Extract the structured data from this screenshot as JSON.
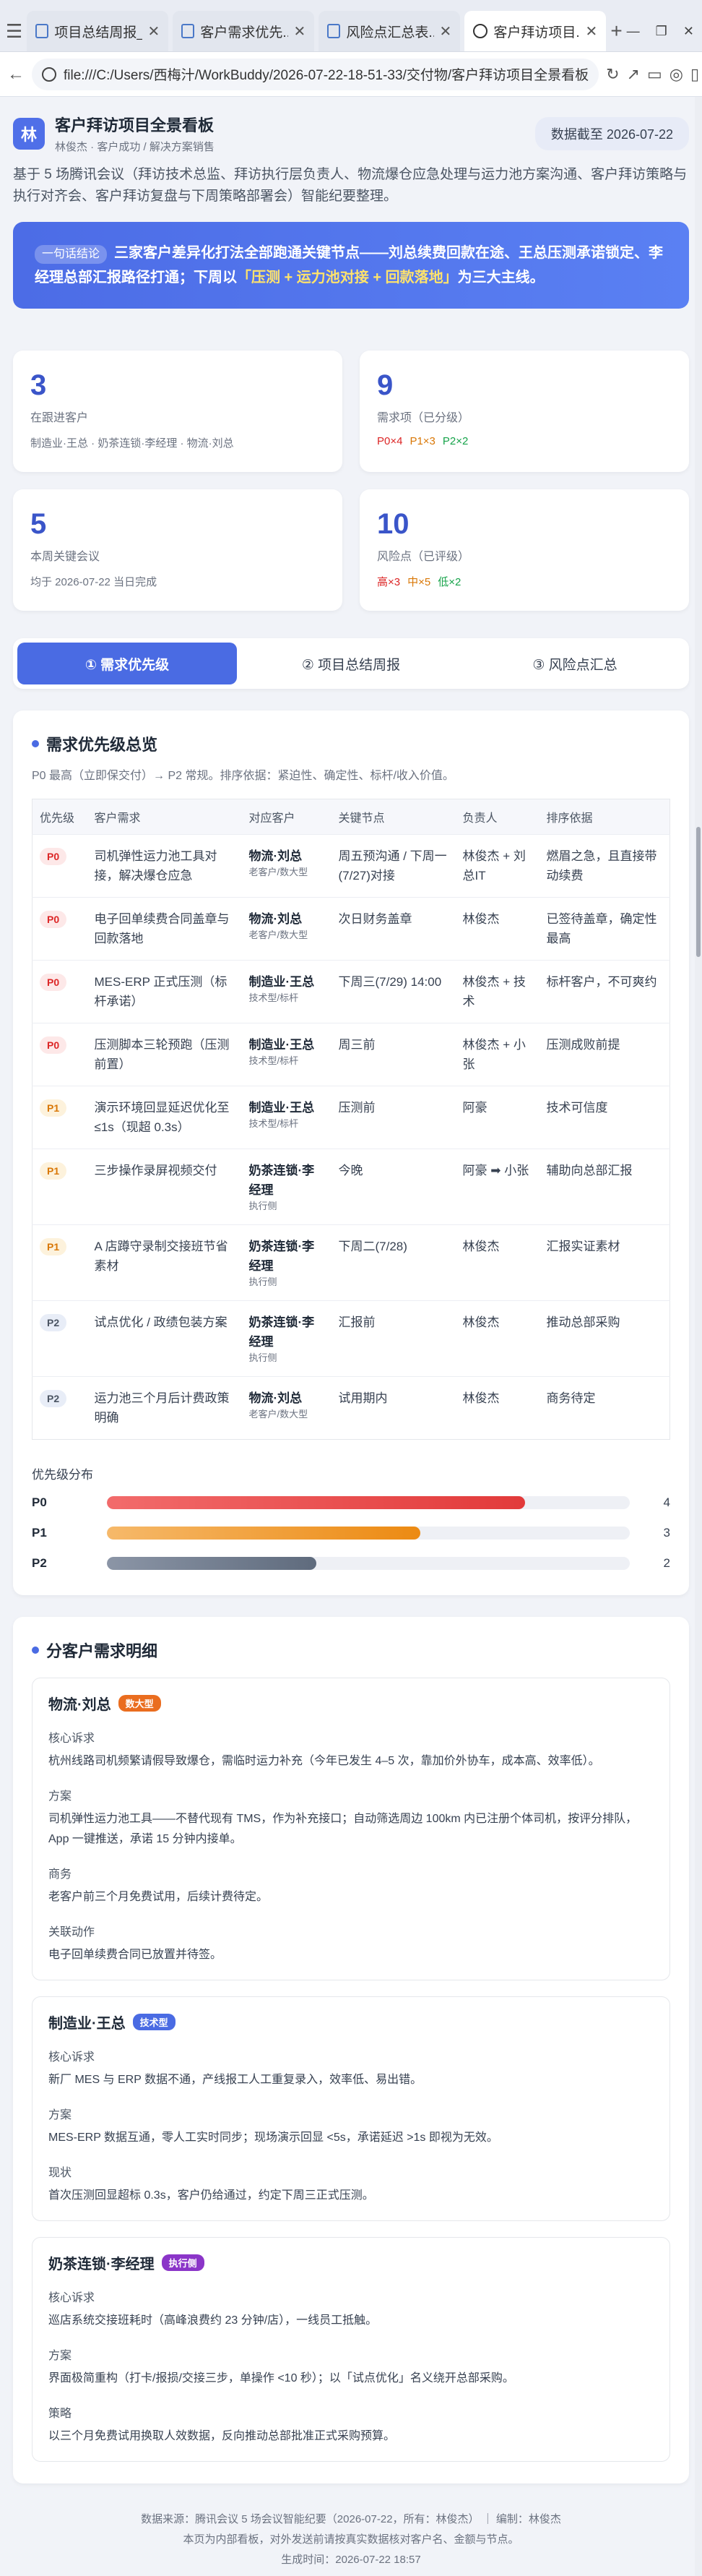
{
  "browser": {
    "tabs": [
      {
        "title": "项目总结周报_..."
      },
      {
        "title": "客户需求优先..."
      },
      {
        "title": "风险点汇总表..."
      },
      {
        "title": "客户拜访项目..."
      }
    ],
    "url": "file:///C:/Users/西梅汁/WorkBuddy/2026-07-22-18-51-33/交付物/客户拜访项目全景看板"
  },
  "header": {
    "logo": "林",
    "title": "客户拜访项目全景看板",
    "subtitle": "林俊杰 · 客户成功 / 解决方案销售",
    "date_badge": "数据截至 2026-07-22"
  },
  "intro": "基于 5 场腾讯会议（拜访技术总监、拜访执行层负责人、物流爆仓应急处理与运力池方案沟通、客户拜访策略与执行对齐会、客户拜访复盘与下周策略部署会）智能纪要整理。",
  "banner": {
    "tag": "一句话结论",
    "text_1": "三家客户差异化打法全部跑通关键节点——刘总续费回款在途、王总压测承诺锁定、李经理总部汇报路径打通；下周以",
    "highlight": "「压测 + 运力池对接 + 回款落地」",
    "text_2": "为三大主线。"
  },
  "stats": [
    {
      "num": "3",
      "label": "在跟进客户",
      "sub": "制造业·王总 · 奶茶连锁·李经理 · 物流·刘总"
    },
    {
      "num": "9",
      "label": "需求项（已分级）",
      "p0": "P0×4",
      "p1": "P1×3",
      "p2": "P2×2"
    },
    {
      "num": "5",
      "label": "本周关键会议",
      "sub": "均于 2026-07-22 当日完成"
    },
    {
      "num": "10",
      "label": "风险点（已评级）",
      "hi": "高×3",
      "mid": "中×5",
      "lo": "低×2"
    }
  ],
  "nav_tabs": [
    "① 需求优先级",
    "② 项目总结周报",
    "③ 风险点汇总"
  ],
  "priority": {
    "title": "需求优先级总览",
    "subtitle": "P0 最高（立即保交付）→ P2 常规。排序依据：紧迫性、确定性、标杆/收入价值。",
    "columns": [
      "优先级",
      "客户需求",
      "对应客户",
      "关键节点",
      "负责人",
      "排序依据"
    ],
    "rows": [
      {
        "p": "P0",
        "need": "司机弹性运力池工具对接，解决爆仓应急",
        "cust": "物流·刘总",
        "ctag": "老客户/数大型",
        "node": "周五预沟通 / 下周一(7/27)对接",
        "owner": "林俊杰 + 刘总IT",
        "basis": "燃眉之急，且直接带动续费"
      },
      {
        "p": "P0",
        "need": "电子回单续费合同盖章与回款落地",
        "cust": "物流·刘总",
        "ctag": "老客户/数大型",
        "node": "次日财务盖章",
        "owner": "林俊杰",
        "basis": "已签待盖章，确定性最高"
      },
      {
        "p": "P0",
        "need": "MES-ERP 正式压测（标杆承诺）",
        "cust": "制造业·王总",
        "ctag": "技术型/标杆",
        "node": "下周三(7/29) 14:00",
        "owner": "林俊杰 + 技术",
        "basis": "标杆客户，不可爽约"
      },
      {
        "p": "P0",
        "need": "压测脚本三轮预跑（压测前置）",
        "cust": "制造业·王总",
        "ctag": "技术型/标杆",
        "node": "周三前",
        "owner": "林俊杰 + 小张",
        "basis": "压测成败前提"
      },
      {
        "p": "P1",
        "need": "演示环境回显延迟优化至 ≤1s（现超 0.3s）",
        "cust": "制造业·王总",
        "ctag": "技术型/标杆",
        "node": "压测前",
        "owner": "阿豪",
        "basis": "技术可信度"
      },
      {
        "p": "P1",
        "need": "三步操作录屏视频交付",
        "cust": "奶茶连锁·李经理",
        "ctag": "执行侧",
        "node": "今晚",
        "owner": "阿豪 ➡ 小张",
        "basis": "辅助向总部汇报"
      },
      {
        "p": "P1",
        "need": "A 店蹲守录制交接班节省素材",
        "cust": "奶茶连锁·李经理",
        "ctag": "执行侧",
        "node": "下周二(7/28)",
        "owner": "林俊杰",
        "basis": "汇报实证素材"
      },
      {
        "p": "P2",
        "need": "试点优化 / 政绩包装方案",
        "cust": "奶茶连锁·李经理",
        "ctag": "执行侧",
        "node": "汇报前",
        "owner": "林俊杰",
        "basis": "推动总部采购"
      },
      {
        "p": "P2",
        "need": "运力池三个月后计费政策明确",
        "cust": "物流·刘总",
        "ctag": "老客户/数大型",
        "node": "试用期内",
        "owner": "林俊杰",
        "basis": "商务待定"
      }
    ],
    "dist_title": "优先级分布",
    "dist": [
      {
        "k": "P0",
        "v": 4
      },
      {
        "k": "P1",
        "v": 3
      },
      {
        "k": "P2",
        "v": 2
      }
    ]
  },
  "details": {
    "title": "分客户需求明细",
    "customers": [
      {
        "name": "物流·刘总",
        "tag": "数大型",
        "items": [
          {
            "label": "核心诉求",
            "text": "杭州线路司机频繁请假导致爆仓，需临时运力补充（今年已发生 4–5 次，靠加价外协车，成本高、效率低）。"
          },
          {
            "label": "方案",
            "text": "司机弹性运力池工具——不替代现有 TMS，作为补充接口；自动筛选周边 100km 内已注册个体司机，按评分排队，App 一键推送，承诺 15 分钟内接单。"
          },
          {
            "label": "商务",
            "text": "老客户前三个月免费试用，后续计费待定。"
          },
          {
            "label": "关联动作",
            "text": "电子回单续费合同已放置并待签。"
          }
        ]
      },
      {
        "name": "制造业·王总",
        "tag": "技术型",
        "items": [
          {
            "label": "核心诉求",
            "text": "新厂 MES 与 ERP 数据不通，产线报工人工重复录入，效率低、易出错。"
          },
          {
            "label": "方案",
            "text": "MES-ERP 数据互通，零人工实时同步；现场演示回显 <5s，承诺延迟 >1s 即视为无效。"
          },
          {
            "label": "现状",
            "text": "首次压测回显超标 0.3s，客户仍给通过，约定下周三正式压测。"
          }
        ]
      },
      {
        "name": "奶茶连锁·李经理",
        "tag": "执行侧",
        "items": [
          {
            "label": "核心诉求",
            "text": "巡店系统交接班耗时（高峰浪费约 23 分钟/店），一线员工抵触。"
          },
          {
            "label": "方案",
            "text": "界面极简重构（打卡/报损/交接三步，单操作 <10 秒）；以「试点优化」名义绕开总部采购。"
          },
          {
            "label": "策略",
            "text": "以三个月免费试用换取人效数据，反向推动总部批准正式采购预算。"
          }
        ]
      }
    ]
  },
  "footer": {
    "line1": "数据来源：腾讯会议 5 场会议智能纪要（2026-07-22，所有：林俊杰） ｜ 编制：林俊杰",
    "line2": "本页为内部看板，对外发送前请按真实数据核对客户名、金额与节点。",
    "line3": "生成时间：2026-07-22 18:57"
  }
}
